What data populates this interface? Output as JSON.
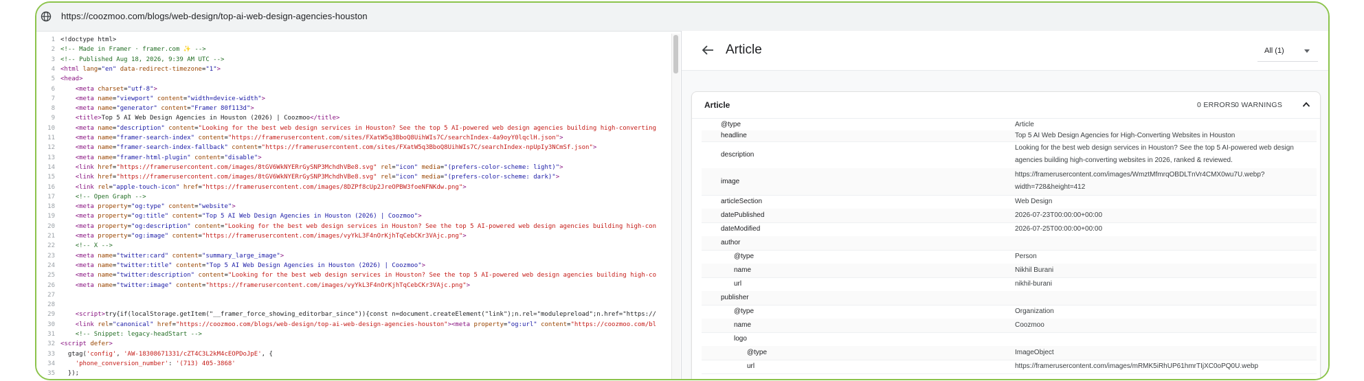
{
  "browser": {
    "url": "https://coozmoo.com/blogs/web-design/top-ai-web-design-agencies-houston"
  },
  "source": {
    "lines": [
      {
        "n": "1",
        "html": "<span class='c-text'>&lt;!doctype html&gt;</span>"
      },
      {
        "n": "2",
        "html": "<span class='cm'>&lt;!-- Made in Framer · framer.com ✨ --&gt;</span>"
      },
      {
        "n": "3",
        "html": "<span class='cm'>&lt;!-- Published Aug 18, 2026, 9:39 AM UTC --&gt;</span>"
      },
      {
        "n": "4",
        "html": "<span class='t'>&lt;html</span> <span class='a'>lang</span>=<span class='v'>\"en\"</span> <span class='a'>data-redirect-timezone</span>=<span class='v'>\"1\"</span><span class='t'>&gt;</span>"
      },
      {
        "n": "5",
        "html": "<span class='t'>&lt;head&gt;</span>"
      },
      {
        "n": "6",
        "html": "    <span class='t'>&lt;meta</span> <span class='a'>charset</span>=<span class='v'>\"utf-8\"</span><span class='t'>&gt;</span>"
      },
      {
        "n": "7",
        "html": "    <span class='t'>&lt;meta</span> <span class='a'>name</span>=<span class='v'>\"viewport\"</span> <span class='a'>content</span>=<span class='v'>\"width=device-width\"</span><span class='t'>&gt;</span>"
      },
      {
        "n": "8",
        "html": "    <span class='t'>&lt;meta</span> <span class='a'>name</span>=<span class='v'>\"generator\"</span> <span class='a'>content</span>=<span class='v'>\"Framer 80f113d\"</span><span class='t'>&gt;</span>"
      },
      {
        "n": "9",
        "html": "    <span class='t'>&lt;title&gt;</span><span class='c-text'>Top 5 AI Web Design Agencies in Houston (2026) | Coozmoo</span><span class='t'>&lt;/title&gt;</span>"
      },
      {
        "n": "10",
        "html": "    <span class='t'>&lt;meta</span> <span class='a'>name</span>=<span class='v'>\"description\"</span> <span class='a'>content</span>=<span class='s'>\"Looking for the best web design services in Houston? See the top 5 AI-powered web design agencies building high-converting</span>"
      },
      {
        "n": "11",
        "html": "    <span class='t'>&lt;meta</span> <span class='a'>name</span>=<span class='v'>\"framer-search-index\"</span> <span class='a'>content</span>=<span class='s'>\"https://framerusercontent.com/sites/FXatW5q3BboQ8UihWIs7C/searchIndex-4a9oyY0lqclH.json\"</span><span class='t'>&gt;</span>"
      },
      {
        "n": "12",
        "html": "    <span class='t'>&lt;meta</span> <span class='a'>name</span>=<span class='v'>\"framer-search-index-fallback\"</span> <span class='a'>content</span>=<span class='s'>\"https://framerusercontent.com/sites/FXatW5q3BboQ8UihWIs7C/searchIndex-npUpIy3NCmSf.json\"</span><span class='t'>&gt;</span>"
      },
      {
        "n": "13",
        "html": "    <span class='t'>&lt;meta</span> <span class='a'>name</span>=<span class='v'>\"framer-html-plugin\"</span> <span class='a'>content</span>=<span class='v'>\"disable\"</span><span class='t'>&gt;</span>"
      },
      {
        "n": "14",
        "html": "    <span class='t'>&lt;link</span> <span class='a'>href</span>=<span class='s'>\"https://framerusercontent.com/images/8tGV6WkNYERrGySNP3MchdhVBe8.svg\"</span> <span class='a'>rel</span>=<span class='v'>\"icon\"</span> <span class='a'>media</span>=<span class='v'>\"(prefers-color-scheme: light)\"</span><span class='t'>&gt;</span>"
      },
      {
        "n": "15",
        "html": "    <span class='t'>&lt;link</span> <span class='a'>href</span>=<span class='s'>\"https://framerusercontent.com/images/8tGV6WkNYERrGySNP3MchdhVBe8.svg\"</span> <span class='a'>rel</span>=<span class='v'>\"icon\"</span> <span class='a'>media</span>=<span class='v'>\"(prefers-color-scheme: dark)\"</span><span class='t'>&gt;</span>"
      },
      {
        "n": "16",
        "html": "    <span class='t'>&lt;link</span> <span class='a'>rel</span>=<span class='v'>\"apple-touch-icon\"</span> <span class='a'>href</span>=<span class='s'>\"https://framerusercontent.com/images/8DZPf8cUp2JreOPBW3foeNFNKdw.png\"</span><span class='t'>&gt;</span>"
      },
      {
        "n": "17",
        "html": "    <span class='cm'>&lt;!-- Open Graph --&gt;</span>"
      },
      {
        "n": "18",
        "html": "    <span class='t'>&lt;meta</span> <span class='a'>property</span>=<span class='v'>\"og:type\"</span> <span class='a'>content</span>=<span class='v'>\"website\"</span><span class='t'>&gt;</span>"
      },
      {
        "n": "19",
        "html": "    <span class='t'>&lt;meta</span> <span class='a'>property</span>=<span class='v'>\"og:title\"</span> <span class='a'>content</span>=<span class='v'>\"Top 5 AI Web Design Agencies in Houston (2026) | Coozmoo\"</span><span class='t'>&gt;</span>"
      },
      {
        "n": "20",
        "html": "    <span class='t'>&lt;meta</span> <span class='a'>property</span>=<span class='v'>\"og:description\"</span> <span class='a'>content</span>=<span class='s'>\"Looking for the best web design services in Houston? See the top 5 AI-powered web design agencies building high-con</span>"
      },
      {
        "n": "21",
        "html": "    <span class='t'>&lt;meta</span> <span class='a'>property</span>=<span class='v'>\"og:image\"</span> <span class='a'>content</span>=<span class='s'>\"https://framerusercontent.com/images/vyYkL3F4nOrKjhTqCebCKr3VAjc.png\"</span><span class='t'>&gt;</span>"
      },
      {
        "n": "22",
        "html": "    <span class='cm'>&lt;!-- X --&gt;</span>"
      },
      {
        "n": "23",
        "html": "    <span class='t'>&lt;meta</span> <span class='a'>name</span>=<span class='v'>\"twitter:card\"</span> <span class='a'>content</span>=<span class='v'>\"summary_large_image\"</span><span class='t'>&gt;</span>"
      },
      {
        "n": "24",
        "html": "    <span class='t'>&lt;meta</span> <span class='a'>name</span>=<span class='v'>\"twitter:title\"</span> <span class='a'>content</span>=<span class='v'>\"Top 5 AI Web Design Agencies in Houston (2026) | Coozmoo\"</span><span class='t'>&gt;</span>"
      },
      {
        "n": "25",
        "html": "    <span class='t'>&lt;meta</span> <span class='a'>name</span>=<span class='v'>\"twitter:description\"</span> <span class='a'>content</span>=<span class='s'>\"Looking for the best web design services in Houston? See the top 5 AI-powered web design agencies building high-co</span>"
      },
      {
        "n": "26",
        "html": "    <span class='t'>&lt;meta</span> <span class='a'>name</span>=<span class='v'>\"twitter:image\"</span> <span class='a'>content</span>=<span class='s'>\"https://framerusercontent.com/images/vyYkL3F4nOrKjhTqCebCKr3VAjc.png\"</span><span class='t'>&gt;</span>"
      },
      {
        "n": "27",
        "html": ""
      },
      {
        "n": "28",
        "html": ""
      },
      {
        "n": "29",
        "html": "    <span class='t'>&lt;script&gt;</span><span class='c-text'>try{if(localStorage.getItem(\"__framer_force_showing_editorbar_since\")){const n=document.createElement(\"link\");n.rel=\"modulepreload\";n.href=\"https://</span>"
      },
      {
        "n": "30",
        "html": "    <span class='t'>&lt;link</span> <span class='a'>rel</span>=<span class='v'>\"canonical\"</span> <span class='a'>href</span>=<span class='s'>\"https://coozmoo.com/blogs/web-design/top-ai-web-design-agencies-houston\"</span><span class='t'>&gt;&lt;meta</span> <span class='a'>property</span>=<span class='v'>\"og:url\"</span> <span class='a'>content</span>=<span class='s'>\"https://coozmoo.com/bl</span>"
      },
      {
        "n": "31",
        "html": "    <span class='cm'>&lt;!-- Snippet: legacy-headStart --&gt;</span>"
      },
      {
        "n": "32",
        "html": "<span class='t'>&lt;script</span> <span class='a'>defer</span><span class='t'>&gt;</span>"
      },
      {
        "n": "33",
        "html": "  <span class='c-text'>gtag(</span><span class='s'>'config'</span><span class='c-text'>, </span><span class='s'>'AW-18308671331/cZT4C3L2kM4cEOPDoJpE'</span><span class='c-text'>, {</span>"
      },
      {
        "n": "34",
        "html": "    <span class='s'>'phone_conversion_number'</span><span class='c-text'>: </span><span class='s'>'(713) 405-3868'</span>"
      },
      {
        "n": "35",
        "html": "  <span class='c-text'>});</span>"
      }
    ]
  },
  "panel": {
    "back_icon": "arrow-left-icon",
    "title": "Article",
    "filter_label": "All (1)",
    "card": {
      "title": "Article",
      "errors": "0 ERRORS",
      "warnings": "0 WARNINGS",
      "rows": [
        {
          "key": "@type",
          "value": "Article",
          "indent": 0,
          "h": 16
        },
        {
          "key": "headline",
          "value": "Top 5 AI Web Design Agencies for High-Converting Websites in Houston",
          "indent": 0,
          "h": 16
        },
        {
          "key": "description",
          "value": "Looking for the best web design services in Houston? See the top 5 AI-powered web design agencies building high-converting websites in 2026, ranked & reviewed.",
          "indent": 0,
          "h": 39
        },
        {
          "key": "image",
          "value": "https://framerusercontent.com/images/WmztMfmrqOBDLTnVr4CMX0wu7U.webp?width=728&height=412",
          "indent": 0,
          "h": 39
        },
        {
          "key": "articleSection",
          "value": "Web Design",
          "indent": 0,
          "h": 20
        },
        {
          "key": "datePublished",
          "value": "2026-07-23T00:00:00+00:00",
          "indent": 0,
          "h": 20
        },
        {
          "key": "dateModified",
          "value": "2026-07-25T00:00:00+00:00",
          "indent": 0,
          "h": 20
        },
        {
          "key": "author",
          "value": "",
          "indent": 0,
          "h": 20
        },
        {
          "key": "@type",
          "value": "Person",
          "indent": 1,
          "h": 20
        },
        {
          "key": "name",
          "value": "Nikhil Burani",
          "indent": 1,
          "h": 20
        },
        {
          "key": "url",
          "value": "nikhil-burani",
          "indent": 1,
          "h": 20
        },
        {
          "key": "publisher",
          "value": "",
          "indent": 0,
          "h": 20
        },
        {
          "key": "@type",
          "value": "Organization",
          "indent": 1,
          "h": 20
        },
        {
          "key": "name",
          "value": "Coozmoo",
          "indent": 1,
          "h": 20
        },
        {
          "key": "logo",
          "value": "",
          "indent": 1,
          "h": 20
        },
        {
          "key": "@type",
          "value": "ImageObject",
          "indent": 2,
          "h": 20
        },
        {
          "key": "url",
          "value": "https://framerusercontent.com/images/mRMK5iRhUP61hmrTIjXC0oPQ0U.webp",
          "indent": 2,
          "h": 20
        }
      ]
    }
  },
  "colors": {
    "frame_border": "#8bc34a",
    "tag": "#881280",
    "attr": "#994500",
    "string": "#c41a16",
    "comment": "#236e25"
  }
}
